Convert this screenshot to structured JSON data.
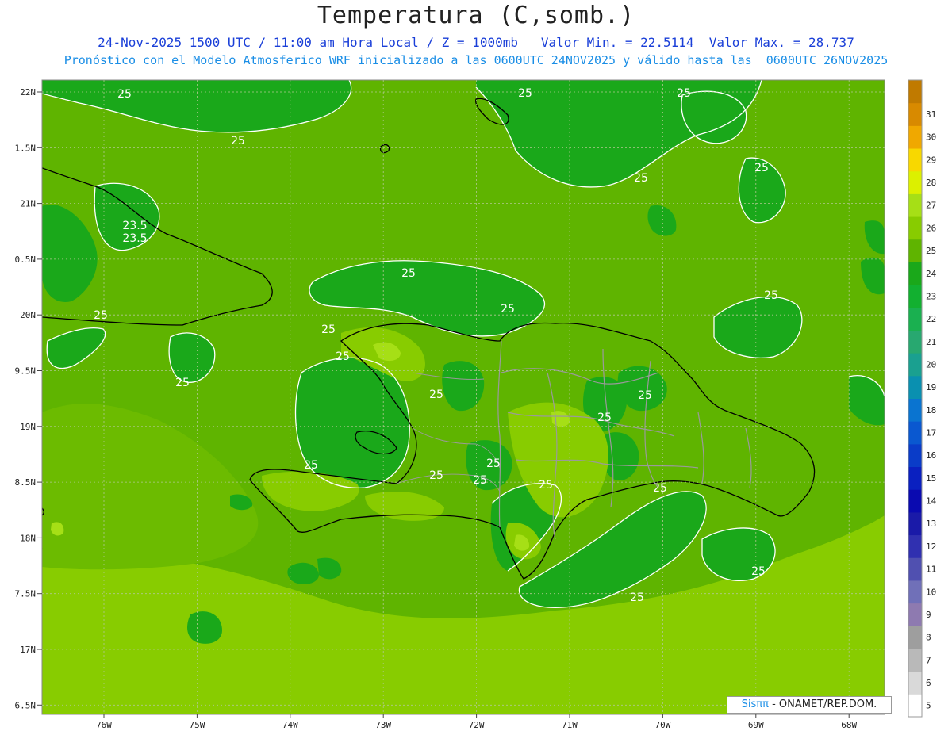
{
  "header": {
    "title": "Temperatura (C,somb.)",
    "subtitle_1": "24-Nov-2025 1500 UTC / 11:00 am Hora Local / Z = 1000mb   Valor Min. = 22.5114  Valor Max. = 28.737",
    "subtitle_2": "Pronóstico con el Modelo Atmosferico WRF inicializado a las 0600UTC_24NOV2025 y válido hasta las  0600UTC_26NOV2025"
  },
  "map": {
    "lat_labels": [
      "22N",
      "1.5N",
      "21N",
      "0.5N",
      "20N",
      "9.5N",
      "19N",
      "8.5N",
      "18N",
      "7.5N",
      "17N",
      "6.5N"
    ],
    "lon_labels": [
      "76W",
      "75W",
      "74W",
      "73W",
      "72W",
      "71W",
      "70W",
      "69W",
      "68W"
    ],
    "contour_labels": [
      "25",
      "25",
      "25",
      "25",
      "25",
      "25",
      "25",
      "23.5",
      "25",
      "25",
      "25",
      "25",
      "25",
      "25",
      "25",
      "25",
      "25",
      "25",
      "25",
      "25",
      "25",
      "25",
      "25",
      "25",
      "25",
      "25",
      "25"
    ],
    "colors": {
      "c24": "#1aa81a",
      "c25": "#5fb400",
      "c25b": "#6cbb00",
      "c26": "#88cc00",
      "c27": "#a6df16",
      "land_line": "#000000",
      "border_line": "#9a9a9a",
      "contour_line": "#ffffff"
    }
  },
  "colorbar": {
    "labels": [
      "5",
      "6",
      "7",
      "8",
      "9",
      "10",
      "11",
      "12",
      "13",
      "14",
      "15",
      "16",
      "17",
      "18",
      "19",
      "20",
      "21",
      "22",
      "23",
      "24",
      "25",
      "26",
      "27",
      "28",
      "29",
      "30",
      "31"
    ],
    "colors": [
      "#ffffff",
      "#d9d9d9",
      "#b9b9b9",
      "#9e9e9e",
      "#8e7ab0",
      "#7070b8",
      "#5050b0",
      "#3030b0",
      "#1a1aa8",
      "#0a0ab0",
      "#0a20c0",
      "#0a3cc8",
      "#0a58d0",
      "#0a74d0",
      "#0a90b0",
      "#1aa090",
      "#28a870",
      "#1ab050",
      "#12b030",
      "#1aa81a",
      "#5fb400",
      "#88cc00",
      "#a6df16",
      "#dcf000",
      "#f8d800",
      "#f0a800",
      "#d88a00",
      "#c07a00"
    ]
  },
  "credit": {
    "brand": "Sisππ",
    "text": "- ONAMET/REP.DOM."
  }
}
